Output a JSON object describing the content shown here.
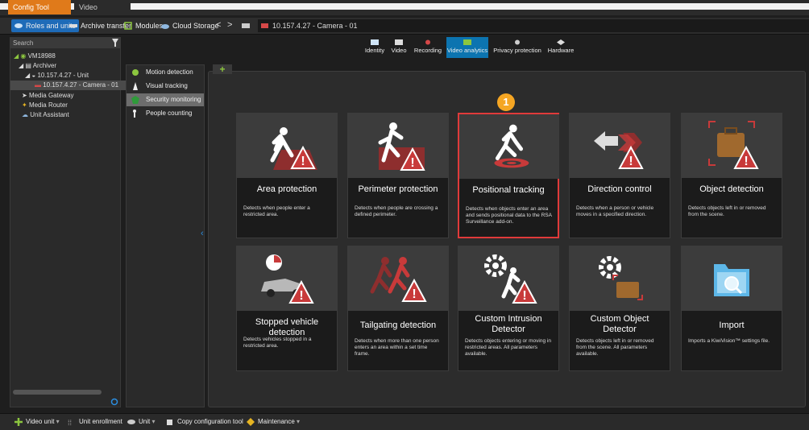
{
  "window_tabs": {
    "config_tool": "Config Tool",
    "video": "Video"
  },
  "toolbar": {
    "roles": "Roles and units",
    "archive": "Archive transfer",
    "modules": "Modules",
    "cloud": "Cloud Storage",
    "back": "<",
    "forward": ">",
    "address": "10.157.4.27 - Camera - 01"
  },
  "tree": {
    "search_placeholder": "Search",
    "items": [
      {
        "label": "VM18988"
      },
      {
        "label": "Archiver"
      },
      {
        "label": "10.157.4.27 - Unit"
      },
      {
        "label": "10.157.4.27 - Camera - 01"
      },
      {
        "label": "Media Gateway"
      },
      {
        "label": "Media Router"
      },
      {
        "label": "Unit Assistant"
      }
    ]
  },
  "top_tabs": [
    {
      "label": "Identity"
    },
    {
      "label": "Video"
    },
    {
      "label": "Recording"
    },
    {
      "label": "Video analytics"
    },
    {
      "label": "Privacy protection"
    },
    {
      "label": "Hardware"
    }
  ],
  "detection_list": [
    {
      "label": "Motion detection"
    },
    {
      "label": "Visual tracking"
    },
    {
      "label": "Security monitoring"
    },
    {
      "label": "People counting"
    }
  ],
  "badge": "1",
  "cards": [
    {
      "title": "Area protection",
      "desc": "Detects when people enter a restricted area."
    },
    {
      "title": "Perimeter protection",
      "desc": "Detects when people are crossing a defined perimeter."
    },
    {
      "title": "Positional tracking",
      "desc": "Detects when objects enter an area and sends positional data to the RSA Surveillance add-on."
    },
    {
      "title": "Direction control",
      "desc": "Detects when a person or vehicle moves in a specified direction."
    },
    {
      "title": "Object detection",
      "desc": "Detects objects left in or removed from the scene."
    },
    {
      "title": "Stopped vehicle detection",
      "desc": "Detects vehicles stopped in a restricted area."
    },
    {
      "title": "Tailgating detection",
      "desc": "Detects when more than one person enters an area within a set time frame."
    },
    {
      "title": "Custom Intrusion Detector",
      "desc": "Detects objects entering or moving in restricted areas. All parameters available."
    },
    {
      "title": "Custom Object Detector",
      "desc": "Detects objects left in or removed from the scene. All parameters available."
    },
    {
      "title": "Import",
      "desc": "Imports a KiwiVision™ settings file."
    }
  ],
  "bottom": {
    "video_unit": "Video unit",
    "unit_enrollment": "Unit enrollment",
    "unit": "Unit",
    "copy_config": "Copy configuration tool",
    "maintenance": "Maintenance"
  },
  "colors": {
    "accent": "#0c74b0",
    "selected_border": "#e03a3a",
    "badge": "#f5a623",
    "warn_red": "#c83a3a"
  }
}
